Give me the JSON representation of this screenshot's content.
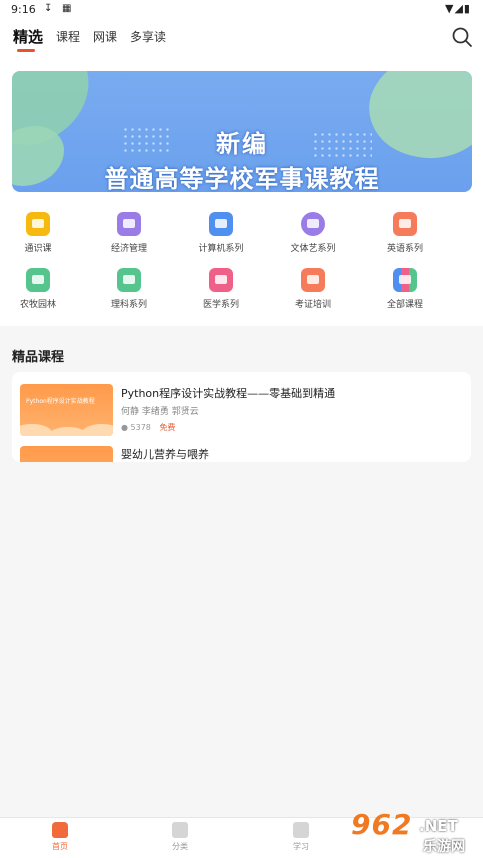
{
  "status": {
    "time": "9:16"
  },
  "tabs": [
    {
      "label": "精选",
      "active": true
    },
    {
      "label": "课程",
      "active": false
    },
    {
      "label": "网课",
      "active": false
    },
    {
      "label": "多享读",
      "active": false
    }
  ],
  "banner": {
    "line1": "新编",
    "line2": "普通高等学校军事课教程"
  },
  "categories": [
    {
      "label": "通识课",
      "icon": "book-icon",
      "color": "#f6b90f"
    },
    {
      "label": "经济管理",
      "icon": "briefcase-icon",
      "color": "#9a7ce6"
    },
    {
      "label": "计算机系列",
      "icon": "terminal-icon",
      "color": "#4f8ff0"
    },
    {
      "label": "文体艺系列",
      "icon": "palette-icon",
      "color": "#9a7ce6"
    },
    {
      "label": "英语系列",
      "icon": "letter-a-icon",
      "color": "#f57b5b"
    },
    {
      "label": "农牧园林",
      "icon": "landscape-icon",
      "color": "#55c58d"
    },
    {
      "label": "理科系列",
      "icon": "calculator-icon",
      "color": "#55c58d"
    },
    {
      "label": "医学系列",
      "icon": "medical-plus-icon",
      "color": "#ef5f88"
    },
    {
      "label": "考证培训",
      "icon": "certificate-icon",
      "color": "#f57b5b"
    },
    {
      "label": "全部课程",
      "icon": "library-icon",
      "color": "#4f8ff0"
    }
  ],
  "featured": {
    "title": "精品课程",
    "courses": [
      {
        "title": "Python程序设计实战教程——零基础到精通",
        "authors": "何静 李绪勇 郭贤云",
        "students": "5378",
        "price": "免费",
        "thumb_text": "Python程序设计实战教程"
      },
      {
        "title": "婴幼儿营养与喂养"
      }
    ]
  },
  "bottom_tabs": [
    {
      "label": "首页",
      "active": true
    },
    {
      "label": "分类",
      "active": false
    },
    {
      "label": "学习",
      "active": false
    }
  ],
  "watermark": {
    "main": "962",
    "suffix": ".NET",
    "sub": "乐游网"
  }
}
